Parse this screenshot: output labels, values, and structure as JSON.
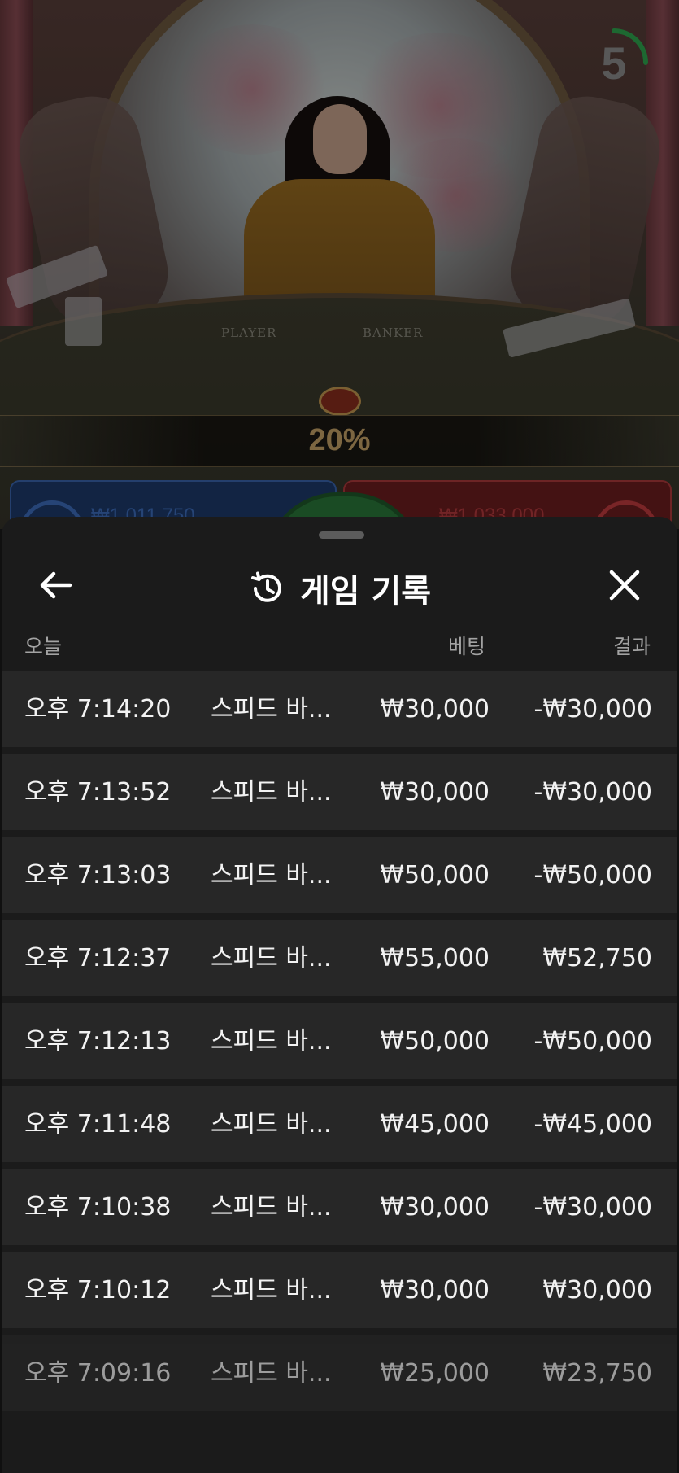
{
  "video": {
    "countdown": "5",
    "table_labels": {
      "player": "PLAYER",
      "banker": "BANKER"
    },
    "percentage": "20%",
    "player_bet": "₩1,011,750",
    "banker_bet": "₩1,033,000"
  },
  "sheet": {
    "title": "게임 기록",
    "icons": {
      "back": "arrow-left-icon",
      "history": "history-icon",
      "close": "close-icon"
    },
    "columns": {
      "date": "오늘",
      "bet": "베팅",
      "result": "결과"
    },
    "rows": [
      {
        "time": "오후 7:14:20",
        "game": "스피드 바...",
        "bet": "₩30,000",
        "result": "-₩30,000"
      },
      {
        "time": "오후 7:13:52",
        "game": "스피드 바...",
        "bet": "₩30,000",
        "result": "-₩30,000"
      },
      {
        "time": "오후 7:13:03",
        "game": "스피드 바...",
        "bet": "₩50,000",
        "result": "-₩50,000"
      },
      {
        "time": "오후 7:12:37",
        "game": "스피드 바...",
        "bet": "₩55,000",
        "result": "₩52,750"
      },
      {
        "time": "오후 7:12:13",
        "game": "스피드 바...",
        "bet": "₩50,000",
        "result": "-₩50,000"
      },
      {
        "time": "오후 7:11:48",
        "game": "스피드 바...",
        "bet": "₩45,000",
        "result": "-₩45,000"
      },
      {
        "time": "오후 7:10:38",
        "game": "스피드 바...",
        "bet": "₩30,000",
        "result": "-₩30,000"
      },
      {
        "time": "오후 7:10:12",
        "game": "스피드 바...",
        "bet": "₩30,000",
        "result": "₩30,000"
      },
      {
        "time": "오후 7:09:16",
        "game": "스피드 바...",
        "bet": "₩25,000",
        "result": "₩23,750"
      }
    ]
  },
  "colors": {
    "sheet_bg": "#1b1b1b",
    "row_bg": "#272727",
    "timer_green": "#2fa84f",
    "percentage_gold": "#c9a56a",
    "player_blue": "#3e6fbf",
    "banker_red": "#b63a3e"
  }
}
